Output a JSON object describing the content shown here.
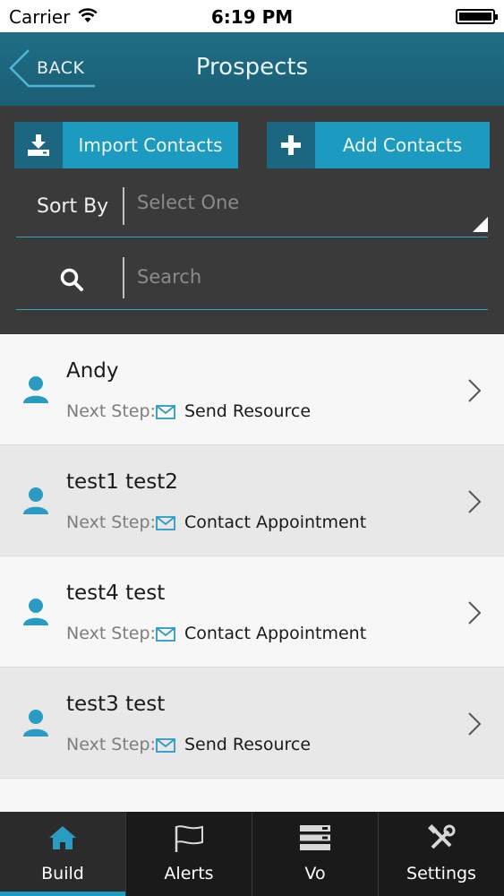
{
  "status_bar": {
    "carrier": "Carrier",
    "time": "6:19 PM"
  },
  "nav": {
    "back_label": "BACK",
    "title": "Prospects"
  },
  "actions": {
    "import_label": "Import Contacts",
    "add_label": "Add Contacts"
  },
  "sort": {
    "label": "Sort By",
    "value": "Select One"
  },
  "search": {
    "placeholder": "Search",
    "value": ""
  },
  "prospects": [
    {
      "name": "Andy",
      "next_step_label": "Next Step:",
      "next_step": "Send Resource"
    },
    {
      "name": "test1 test2",
      "next_step_label": "Next Step:",
      "next_step": "Contact Appointment"
    },
    {
      "name": "test4 test",
      "next_step_label": "Next Step:",
      "next_step": "Contact Appointment"
    },
    {
      "name": "test3 test",
      "next_step_label": "Next Step:",
      "next_step": "Send Resource"
    }
  ],
  "tabs": [
    {
      "label": "Build",
      "icon": "home-icon",
      "active": true
    },
    {
      "label": "Alerts",
      "icon": "flag-icon",
      "active": false
    },
    {
      "label": "Vo",
      "icon": "list-icon",
      "active": false
    },
    {
      "label": "Settings",
      "icon": "tools-icon",
      "active": false
    }
  ],
  "colors": {
    "accent": "#1c9ac0",
    "nav_bg": "#1f6e86",
    "panel_bg": "#3a3a3a",
    "tab_bg": "#1a1a1a"
  }
}
